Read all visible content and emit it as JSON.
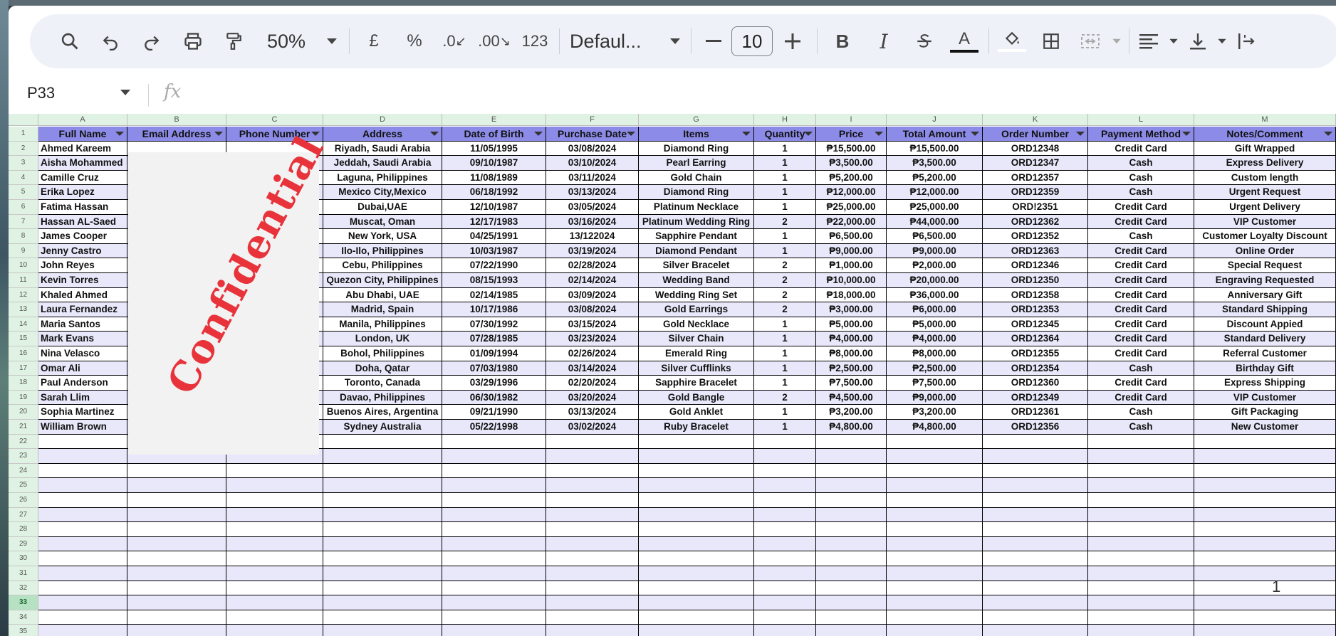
{
  "toolbar": {
    "zoom": "50%",
    "currency_symbol": "£",
    "percent_symbol": "%",
    "decrease_decimals": ".0",
    "increase_decimals": ".00",
    "number_format": "123",
    "font_name": "Defaul...",
    "font_size": "10",
    "bold": "B",
    "italic": "I",
    "text_color_letter": "A",
    "icons": [
      "search-icon",
      "undo-icon",
      "redo-icon",
      "print-icon",
      "paint-format-icon",
      "zoom-dropdown-icon",
      "decrease-font-icon",
      "increase-font-icon",
      "strikethrough-icon",
      "fill-color-icon",
      "borders-icon",
      "merge-cells-icon",
      "align-icon",
      "valign-icon",
      "text-direction-icon"
    ]
  },
  "formula_bar": {
    "name_box": "P33",
    "fx": "fx"
  },
  "column_letters": [
    "A",
    "B",
    "C",
    "D",
    "E",
    "F",
    "G",
    "H",
    "I",
    "J",
    "K",
    "L",
    "M"
  ],
  "headers": [
    "Full Name",
    "Email Address",
    "Phone Number",
    "Address",
    "Date of Birth",
    "Purchase Date",
    "Items",
    "Quantity",
    "Price",
    "Total Amount",
    "Order Number",
    "Payment Method",
    "Notes/Comment"
  ],
  "rows": [
    [
      "Ahmed Kareem",
      "",
      "",
      "Riyadh, Saudi Arabia",
      "11/05/1995",
      "03/08/2024",
      "Diamond Ring",
      "1",
      "₱15,500.00",
      "₱15,500.00",
      "ORD12348",
      "Credit Card",
      "Gift Wrapped"
    ],
    [
      "Aisha Mohammed",
      "",
      "",
      "Jeddah, Saudi Arabia",
      "09/10/1987",
      "03/10/2024",
      "Pearl Earring",
      "1",
      "₱3,500.00",
      "₱3,500.00",
      "ORD12347",
      "Cash",
      "Express Delivery"
    ],
    [
      "Camille Cruz",
      "",
      "",
      "Laguna, Philippines",
      "11/08/1989",
      "03/11/2024",
      "Gold Chain",
      "1",
      "₱5,200.00",
      "₱5,200.00",
      "ORD12357",
      "Cash",
      "Custom length"
    ],
    [
      "Erika Lopez",
      "",
      "",
      "Mexico City,Mexico",
      "06/18/1992",
      "03/13/2024",
      "Diamond Ring",
      "1",
      "₱12,000.00",
      "₱12,000.00",
      "ORD12359",
      "Cash",
      "Urgent Request"
    ],
    [
      "Fatima Hassan",
      "",
      "",
      "Dubai,UAE",
      "12/10/1987",
      "03/05/2024",
      "Platinum Necklace",
      "1",
      "₱25,000.00",
      "₱25,000.00",
      "ORD!2351",
      "Credit Card",
      "Urgent Delivery"
    ],
    [
      "Hassan AL-Saed",
      "",
      "",
      "Muscat, Oman",
      "12/17/1983",
      "03/16/2024",
      "Platinum Wedding Ring",
      "2",
      "₱22,000.00",
      "₱44,000.00",
      "ORD12362",
      "Credit Card",
      "VIP Customer"
    ],
    [
      "James Cooper",
      "",
      "",
      "New York, USA",
      "04/25/1991",
      "13/122024",
      "Sapphire Pendant",
      "1",
      "₱6,500.00",
      "₱6,500.00",
      "ORD12352",
      "Cash",
      "Customer Loyalty Discount"
    ],
    [
      "Jenny Castro",
      "",
      "",
      "Ilo-Ilo, Philippines",
      "10/03/1987",
      "03/19/2024",
      "Diamond Pendant",
      "1",
      "₱9,000.00",
      "₱9,000.00",
      "ORD12363",
      "Credit Card",
      "Online Order"
    ],
    [
      "John Reyes",
      "",
      "",
      "Cebu, Philippines",
      "07/22/1990",
      "02/28/2024",
      "Silver Bracelet",
      "2",
      "₱1,000.00",
      "₱2,000.00",
      "ORD12346",
      "Credit Card",
      "Special Request"
    ],
    [
      "Kevin Torres",
      "",
      "",
      "Quezon City, Philippines",
      "08/15/1993",
      "02/14/2024",
      "Wedding Band",
      "2",
      "₱10,000.00",
      "₱20,000.00",
      "ORD12350",
      "Credit Card",
      "Engraving Requested"
    ],
    [
      "Khaled Ahmed",
      "",
      "",
      "Abu Dhabi, UAE",
      "02/14/1985",
      "03/09/2024",
      "Wedding Ring Set",
      "2",
      "₱18,000.00",
      "₱36,000.00",
      "ORD12358",
      "Credit Card",
      "Anniversary Gift"
    ],
    [
      "Laura Fernandez",
      "",
      "",
      "Madrid, Spain",
      "10/17/1986",
      "03/08/2024",
      "Gold Earrings",
      "2",
      "₱3,000.00",
      "₱6,000.00",
      "ORD12353",
      "Credit Card",
      "Standard Shipping"
    ],
    [
      "Maria Santos",
      "",
      "",
      "Manila, Philippines",
      "07/30/1992",
      "03/15/2024",
      "Gold Necklace",
      "1",
      "₱5,000.00",
      "₱5,000.00",
      "ORD12345",
      "Credit Card",
      "Discount Appied"
    ],
    [
      "Mark Evans",
      "",
      "",
      "London, UK",
      "07/28/1985",
      "03/23/2024",
      "Silver Chain",
      "1",
      "₱4,000.00",
      "₱4,000.00",
      "ORD12364",
      "Credit Card",
      "Standard Delivery"
    ],
    [
      "Nina Velasco",
      "",
      "",
      "Bohol, Philippines",
      "01/09/1994",
      "02/26/2024",
      "Emerald Ring",
      "1",
      "₱8,000.00",
      "₱8,000.00",
      "ORD12355",
      "Credit Card",
      "Referral Customer"
    ],
    [
      "Omar Ali",
      "",
      "",
      "Doha, Qatar",
      "07/03/1980",
      "03/14/2024",
      "Silver Cufflinks",
      "1",
      "₱2,500.00",
      "₱2,500.00",
      "ORD12354",
      "Cash",
      "Birthday Gift"
    ],
    [
      "Paul Anderson",
      "",
      "",
      "Toronto, Canada",
      "03/29/1996",
      "02/20/2024",
      "Sapphire Bracelet",
      "1",
      "₱7,500.00",
      "₱7,500.00",
      "ORD12360",
      "Credit Card",
      "Express Shipping"
    ],
    [
      "Sarah Llim",
      "",
      "",
      "Davao, Philippines",
      "06/30/1982",
      "03/20/2024",
      "Gold Bangle",
      "2",
      "₱4,500.00",
      "₱9,000.00",
      "ORD12349",
      "Credit Card",
      "VIP Customer"
    ],
    [
      "Sophia Martinez",
      "",
      "",
      "Buenos Aires, Argentina",
      "09/21/1990",
      "03/13/2024",
      "Gold Anklet",
      "1",
      "₱3,200.00",
      "₱3,200.00",
      "ORD12361",
      "Cash",
      "Gift Packaging"
    ],
    [
      "William Brown",
      "",
      "",
      "Sydney Australia",
      "05/22/1998",
      "03/02/2024",
      "Ruby Bracelet",
      "1",
      "₱4,800.00",
      "₱4,800.00",
      "ORD12356",
      "Cash",
      "New Customer"
    ]
  ],
  "row_numbers": [
    "1",
    "2",
    "3",
    "4",
    "5",
    "6",
    "7",
    "8",
    "9",
    "10",
    "11",
    "12",
    "13",
    "14",
    "15",
    "16",
    "17",
    "18",
    "19",
    "20",
    "21",
    "22",
    "23",
    "24",
    "25",
    "26",
    "27",
    "28",
    "29",
    "30",
    "31",
    "32",
    "33",
    "34",
    "35"
  ],
  "selected_row": "33",
  "watermark": "Confidential",
  "page_number": "1",
  "colors": {
    "header_bg": "#8c8ce8",
    "band_bg": "#e9e8fb",
    "watermark": "#e8333b",
    "row_header_bg": "#dff2e3"
  }
}
